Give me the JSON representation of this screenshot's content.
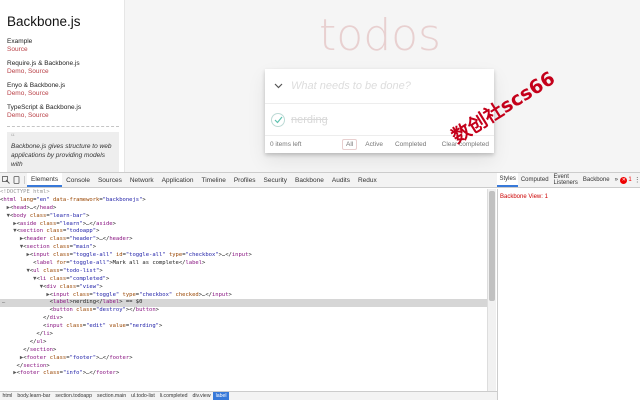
{
  "learn": {
    "title": "Backbone.js",
    "groups": [
      {
        "title": "Example",
        "links": [
          "Source"
        ]
      },
      {
        "title": "Require.js & Backbone.js",
        "links": [
          "Demo",
          "Source"
        ]
      },
      {
        "title": "Enyo & Backbone.js",
        "links": [
          "Demo",
          "Source"
        ]
      },
      {
        "title": "TypeScript & Backbone.js",
        "links": [
          "Demo",
          "Source"
        ]
      }
    ],
    "quote": "Backbone.js gives structure to web applications by providing models with"
  },
  "todo": {
    "title": "todos",
    "placeholder": "What needs to be done?",
    "item": "nerding",
    "items_left": "0 items left",
    "filters": [
      "All",
      "Active",
      "Completed"
    ],
    "clear": "Clear completed"
  },
  "stamp": "数创社scs66",
  "devtools": {
    "tabs": [
      "Elements",
      "Console",
      "Sources",
      "Network",
      "Application",
      "Timeline",
      "Profiles",
      "Security",
      "Backbone",
      "Audits",
      "Redux"
    ],
    "side_tabs": [
      "Styles",
      "Computed",
      "Event Listeners",
      "Backbone"
    ],
    "more": "»",
    "error_count": "1",
    "side_content": "Backbone View: 1",
    "breadcrumbs": [
      "html",
      "body.learn-bar",
      "section.todoapp",
      "section.main",
      "ul.todo-list",
      "li.completed",
      "div.view",
      "label"
    ]
  },
  "colors": {
    "accent": "#3879d9",
    "todo_title": "#af2f2f",
    "stamp": "#c4001a",
    "link": "#b83f45"
  }
}
